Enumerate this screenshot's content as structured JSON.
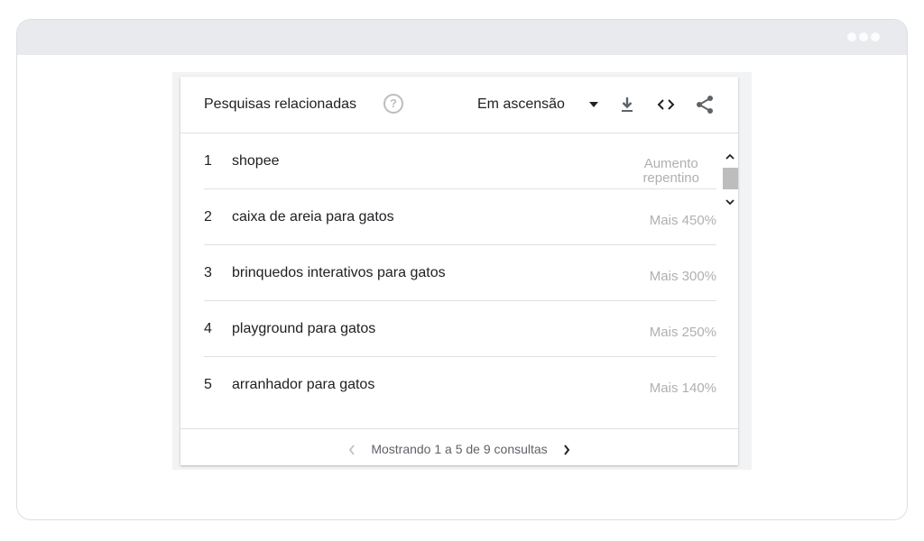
{
  "widget": {
    "title": "Pesquisas relacionadas",
    "help_icon_glyph": "?",
    "filter_label": "Em ascensão",
    "icons": [
      "help-icon",
      "dropdown-arrow-icon",
      "download-icon",
      "embed-code-icon",
      "share-icon"
    ]
  },
  "rows": [
    {
      "rank": "1",
      "query": "shopee",
      "value_line1": "Aumento",
      "value_line2": "repentino"
    },
    {
      "rank": "2",
      "query": "caixa de areia para gatos",
      "value": "Mais 450%"
    },
    {
      "rank": "3",
      "query": "brinquedos interativos para gatos",
      "value": "Mais 300%"
    },
    {
      "rank": "4",
      "query": "playground para gatos",
      "value": "Mais 250%"
    },
    {
      "rank": "5",
      "query": "arranhador para gatos",
      "value": "Mais 140%"
    }
  ],
  "pagination": {
    "text": "Mostrando 1 a 5 de 9 consultas",
    "prev_glyph": "‹",
    "next_glyph": "›"
  },
  "colors": {
    "text": "#202124",
    "muted_value": "#b0b0b0",
    "browser_bar": "#e8eaed"
  }
}
